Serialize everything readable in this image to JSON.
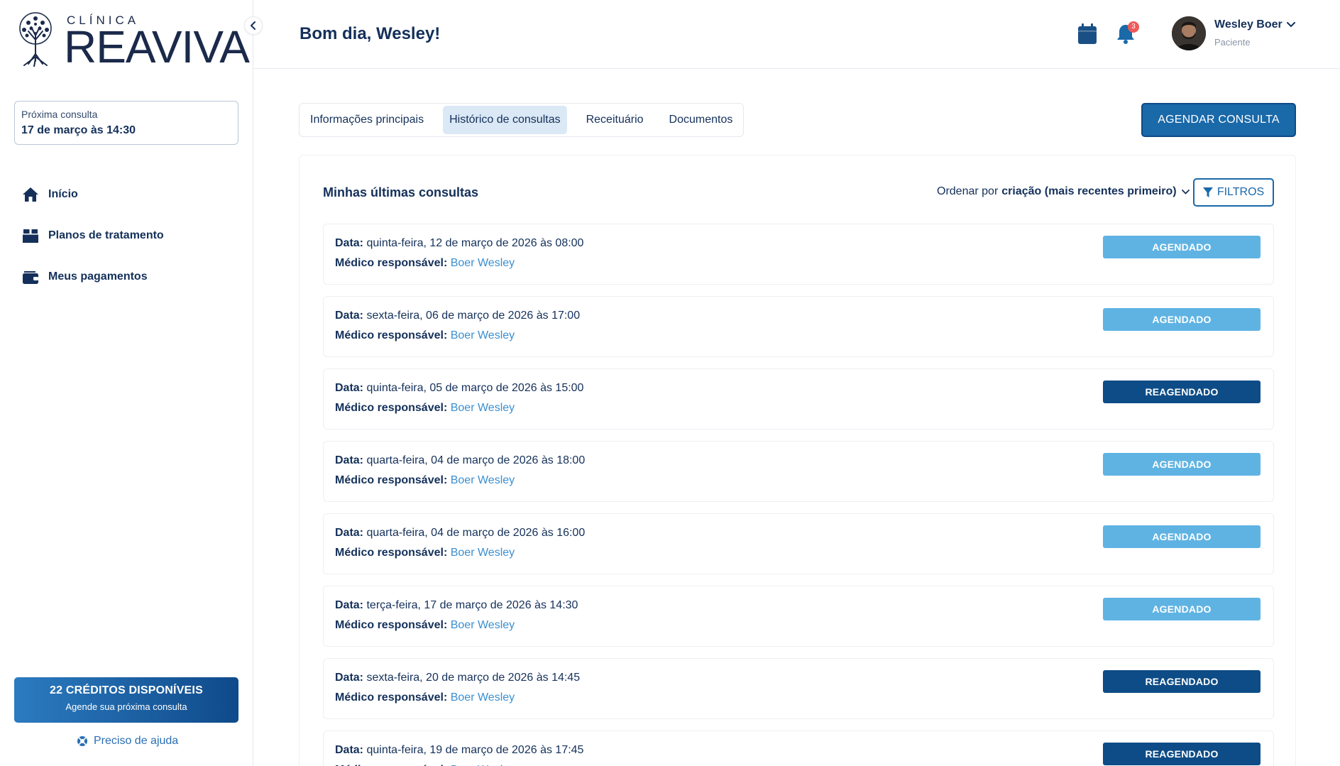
{
  "brand": {
    "small": "CLÍNICA",
    "big": "REAVIVA"
  },
  "sidebar": {
    "next": {
      "label": "Próxima consulta",
      "value": "17 de março às 14:30"
    },
    "items": [
      {
        "label": "Início",
        "icon": "home-icon"
      },
      {
        "label": "Planos de tratamento",
        "icon": "box-icon"
      },
      {
        "label": "Meus pagamentos",
        "icon": "wallet-icon"
      }
    ],
    "credits": {
      "title": "22 CRÉDITOS DISPONÍVEIS",
      "subtitle": "Agende sua próxima consulta"
    },
    "help": "Preciso de ajuda"
  },
  "header": {
    "greeting": "Bom dia, Wesley!",
    "notifications": "3",
    "user": {
      "name": "Wesley Boer",
      "role": "Paciente"
    }
  },
  "tabs": [
    {
      "label": "Informações principais",
      "active": false
    },
    {
      "label": "Histórico de consultas",
      "active": true
    },
    {
      "label": "Receituário",
      "active": false
    },
    {
      "label": "Documentos",
      "active": false
    }
  ],
  "schedule_button": "AGENDAR CONSULTA",
  "panel": {
    "title": "Minhas últimas consultas",
    "sort_prefix": "Ordenar por",
    "sort_value": "criação (mais recentes primeiro)",
    "filters": "FILTROS",
    "date_label": "Data:",
    "doctor_label": "Médico responsável:",
    "appointments": [
      {
        "date": "quinta-feira, 12 de março de 2026 às 08:00",
        "doctor": "Boer Wesley",
        "status": "AGENDADO"
      },
      {
        "date": "sexta-feira, 06 de março de 2026 às 17:00",
        "doctor": "Boer Wesley",
        "status": "AGENDADO"
      },
      {
        "date": "quinta-feira, 05 de março de 2026 às 15:00",
        "doctor": "Boer Wesley",
        "status": "REAGENDADO"
      },
      {
        "date": "quarta-feira, 04 de março de 2026 às 18:00",
        "doctor": "Boer Wesley",
        "status": "AGENDADO"
      },
      {
        "date": "quarta-feira, 04 de março de 2026 às 16:00",
        "doctor": "Boer Wesley",
        "status": "AGENDADO"
      },
      {
        "date": "terça-feira, 17 de março de 2026 às 14:30",
        "doctor": "Boer Wesley",
        "status": "AGENDADO"
      },
      {
        "date": "sexta-feira, 20 de março de 2026 às 14:45",
        "doctor": "Boer Wesley",
        "status": "REAGENDADO"
      },
      {
        "date": "quinta-feira, 19 de março de 2026 às 17:45",
        "doctor": "Boer Wesley",
        "status": "REAGENDADO"
      }
    ]
  },
  "colors": {
    "primary": "#1a69a9",
    "navy": "#14305a",
    "status_agendado": "#5fb3e3",
    "status_reagendado": "#0d4c86"
  }
}
